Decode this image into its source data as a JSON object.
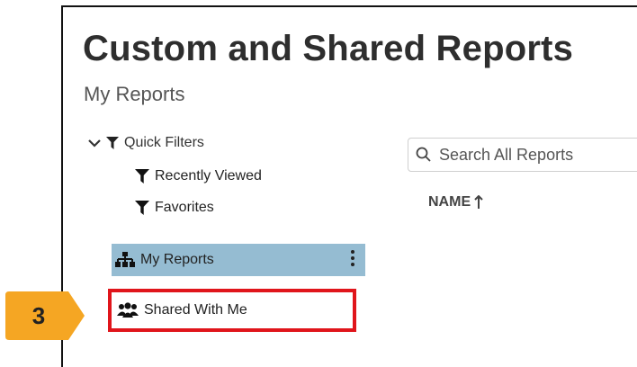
{
  "header": {
    "title": "Custom and Shared Reports",
    "subtitle": "My Reports"
  },
  "sidebar": {
    "quick_filters_label": "Quick Filters",
    "filters": [
      {
        "label": "Recently Viewed",
        "icon": "filter-icon"
      },
      {
        "label": "Favorites",
        "icon": "filter-icon"
      }
    ],
    "my_reports": {
      "label": "My Reports",
      "icon": "hierarchy-icon",
      "selected": true
    },
    "shared_with_me": {
      "label": "Shared With Me",
      "icon": "users-icon",
      "highlighted": true
    }
  },
  "search": {
    "placeholder": "Search All Reports"
  },
  "table": {
    "columns": [
      {
        "label": "NAME",
        "sort": "ascending"
      }
    ]
  },
  "callout": {
    "number": "3"
  },
  "colors": {
    "selected_bg": "#95bcd2",
    "highlight_border": "#e0151b",
    "callout_fill": "#f5a623"
  }
}
